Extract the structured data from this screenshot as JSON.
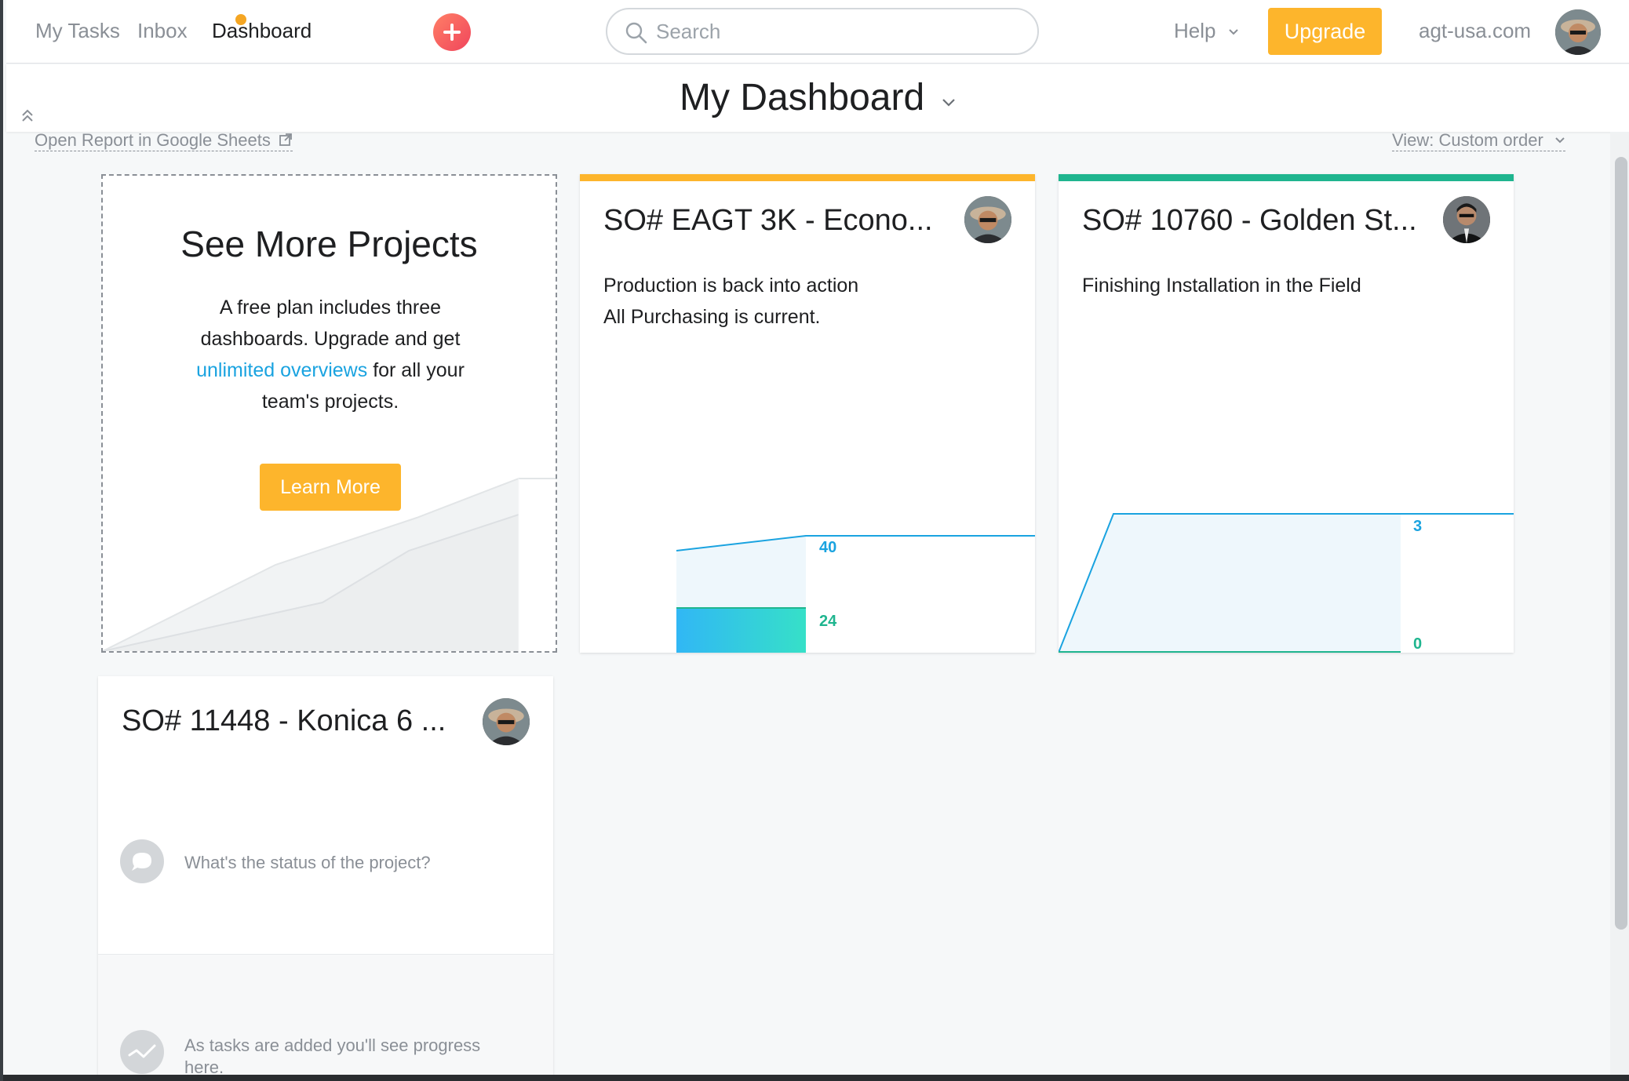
{
  "topnav": {
    "my_tasks": "My Tasks",
    "inbox": "Inbox",
    "dashboard": "Dashboard",
    "search_placeholder": "Search",
    "help": "Help",
    "upgrade": "Upgrade",
    "workspace": "agt-usa.com"
  },
  "header": {
    "title": "My Dashboard",
    "open_report": "Open Report in Google Sheets",
    "view": "View: Custom order"
  },
  "promo": {
    "title": "See More Projects",
    "text_before": "A free plan includes three dashboards. Upgrade and get",
    "link": "unlimited overviews",
    "text_after": "for all your team's projects.",
    "button": "Learn More"
  },
  "projects": [
    {
      "title": "SO# EAGT 3K - Econo...",
      "status_lines": [
        "Production is back into action",
        "All Purchasing is current."
      ],
      "color": "#fdb52c",
      "chart": {
        "total": 40,
        "completed": 24
      }
    },
    {
      "title": "SO# 10760 - Golden St...",
      "status_lines": [
        "Finishing Installation in the Field"
      ],
      "color": "#1fb58f",
      "chart": {
        "total": 3,
        "completed": 0
      }
    },
    {
      "title": "SO# 11448 - Konica 6 ...",
      "status_prompt": "What's the status of the project?",
      "progress_note": "As tasks are added you'll see progress here."
    }
  ],
  "colors": {
    "accent_orange": "#fdb52c",
    "accent_teal": "#1fb58f",
    "chart_blue": "#1aa3e0",
    "chart_teal": "#1fc3a8",
    "add_button": "#f0455c"
  }
}
